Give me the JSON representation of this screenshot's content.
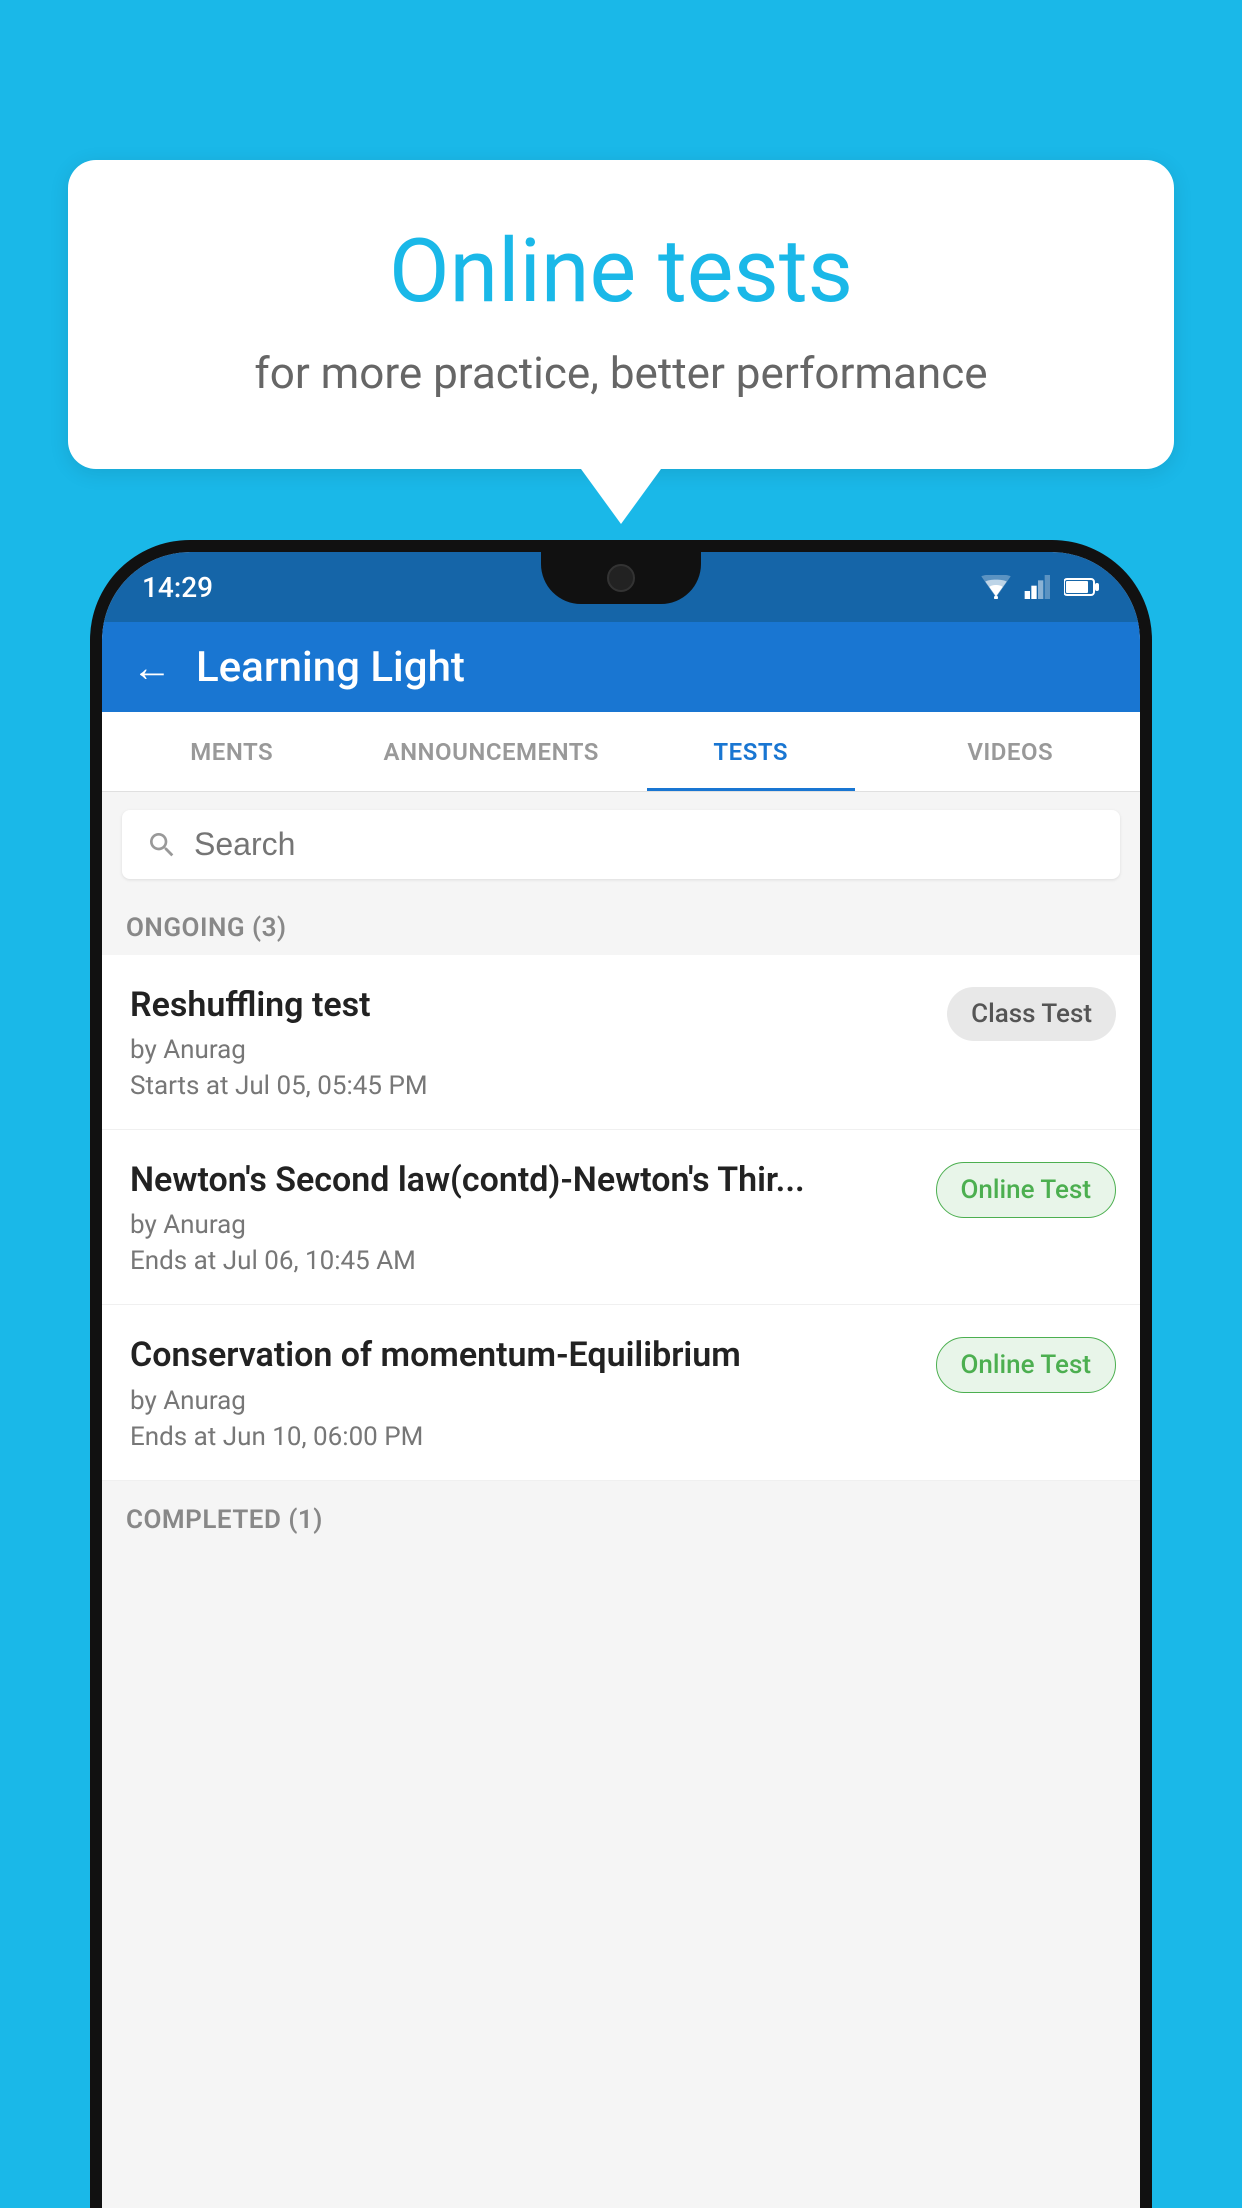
{
  "background_color": "#1ab8e8",
  "speech_bubble": {
    "title": "Online tests",
    "subtitle": "for more practice, better performance"
  },
  "phone": {
    "status_bar": {
      "time": "14:29",
      "icons": [
        "wifi",
        "signal",
        "battery"
      ]
    },
    "header": {
      "title": "Learning Light",
      "back_label": "←"
    },
    "tabs": [
      {
        "label": "MENTS",
        "active": false
      },
      {
        "label": "ANNOUNCEMENTS",
        "active": false
      },
      {
        "label": "TESTS",
        "active": true
      },
      {
        "label": "VIDEOS",
        "active": false
      }
    ],
    "search": {
      "placeholder": "Search"
    },
    "ongoing_section": {
      "label": "ONGOING (3)"
    },
    "tests": [
      {
        "name": "Reshuffling test",
        "by": "by Anurag",
        "date": "Starts at  Jul 05, 05:45 PM",
        "badge": "Class Test",
        "badge_type": "class"
      },
      {
        "name": "Newton's Second law(contd)-Newton's Thir...",
        "by": "by Anurag",
        "date": "Ends at  Jul 06, 10:45 AM",
        "badge": "Online Test",
        "badge_type": "online"
      },
      {
        "name": "Conservation of momentum-Equilibrium",
        "by": "by Anurag",
        "date": "Ends at  Jun 10, 06:00 PM",
        "badge": "Online Test",
        "badge_type": "online"
      }
    ],
    "completed_section": {
      "label": "COMPLETED (1)"
    }
  }
}
